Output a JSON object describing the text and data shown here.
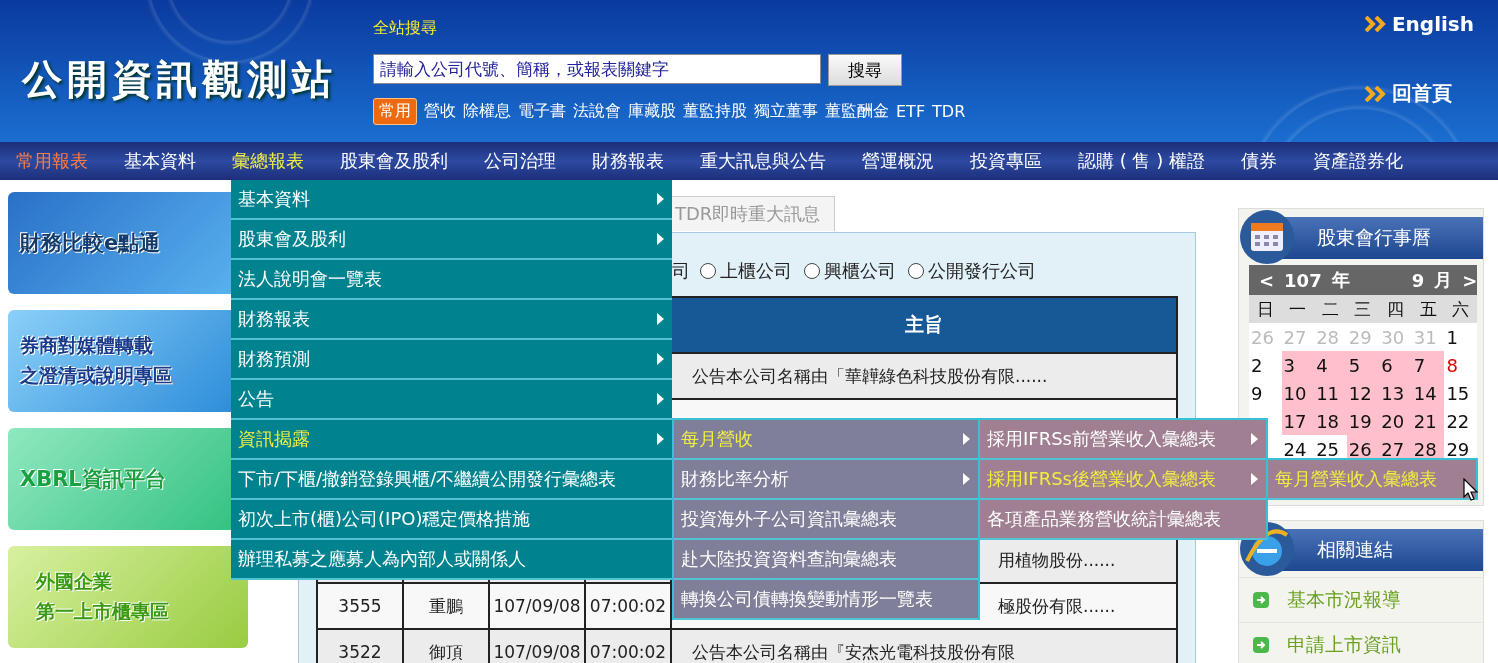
{
  "header": {
    "logo": "公開資訊觀測站",
    "search_label": "全站搜尋",
    "search": {
      "placeholder": "請輸入公司代號、簡稱，或報表關鍵字"
    },
    "search_button": "搜尋",
    "quick_badge": "常用",
    "quick_links": [
      "營收",
      "除權息",
      "電子書",
      "法說會",
      "庫藏股",
      "董監持股",
      "獨立董事",
      "董監酬金",
      "ETF",
      "TDR"
    ],
    "english_link": "English",
    "home_link": "回首頁"
  },
  "nav": [
    {
      "label": "常用報表",
      "selected": true,
      "open": false
    },
    {
      "label": "基本資料",
      "selected": false,
      "open": false
    },
    {
      "label": "彙總報表",
      "selected": false,
      "open": true,
      "menu": [
        {
          "label": "基本資料",
          "has_submenu": true,
          "active": false
        },
        {
          "label": "股東會及股利",
          "has_submenu": true,
          "active": false
        },
        {
          "label": "法人說明會一覽表",
          "has_submenu": false,
          "active": false
        },
        {
          "label": "財務報表",
          "has_submenu": true,
          "active": false
        },
        {
          "label": "財務預測",
          "has_submenu": true,
          "active": false
        },
        {
          "label": "公告",
          "has_submenu": true,
          "active": false
        },
        {
          "label": "資訊揭露",
          "has_submenu": true,
          "active": true,
          "children": [
            {
              "label": "每月營收",
              "has_submenu": true,
              "active": true,
              "children": [
                {
                  "label": "採用IFRSs前營業收入彙總表",
                  "has_submenu": true,
                  "active": false
                },
                {
                  "label": "採用IFRSs後營業收入彙總表",
                  "has_submenu": true,
                  "active": true,
                  "children": [
                    {
                      "label": "每月營業收入彙總表",
                      "has_submenu": false,
                      "active": true
                    }
                  ]
                },
                {
                  "label": "各項產品業務營收統計彙總表",
                  "has_submenu": false,
                  "active": false
                }
              ]
            },
            {
              "label": "財務比率分析",
              "has_submenu": true,
              "active": false
            },
            {
              "label": "投資海外子公司資訊彙總表",
              "has_submenu": false,
              "active": false
            },
            {
              "label": "赴大陸投資資料查詢彙總表",
              "has_submenu": false,
              "active": false
            },
            {
              "label": "轉換公司債轉換變動情形一覽表",
              "has_submenu": false,
              "active": false
            }
          ]
        },
        {
          "label": "下市/下櫃/撤銷登錄興櫃/不繼續公開發行彙總表",
          "has_submenu": false,
          "active": false
        },
        {
          "label": "初次上市(櫃)公司(IPO)穩定價格措施",
          "has_submenu": false,
          "active": false
        },
        {
          "label": "辦理私募之應募人為內部人或關係人",
          "has_submenu": false,
          "active": false
        }
      ]
    },
    {
      "label": "股東會及股利",
      "selected": false,
      "open": false
    },
    {
      "label": "公司治理",
      "selected": false,
      "open": false
    },
    {
      "label": "財務報表",
      "selected": false,
      "open": false
    },
    {
      "label": "重大訊息與公告",
      "selected": false,
      "open": false
    },
    {
      "label": "營運概況",
      "selected": false,
      "open": false
    },
    {
      "label": "投資專區",
      "selected": false,
      "open": false
    },
    {
      "label": "認購 ( 售 ) 權證",
      "selected": false,
      "open": false
    },
    {
      "label": "債券",
      "selected": false,
      "open": false
    },
    {
      "label": "資產證券化",
      "selected": false,
      "open": false
    }
  ],
  "banners": [
    {
      "lines": [
        "財務比較e點通"
      ]
    },
    {
      "lines": [
        "券商對媒體轉載",
        "之澄清或說明專區"
      ]
    },
    {
      "lines": [
        "XBRL資訊平台"
      ]
    },
    {
      "lines": [
        "外國企業",
        "第一上市櫃專區"
      ]
    }
  ],
  "tabs": [
    {
      "label": "TDR即時重大訊息",
      "selected": false
    }
  ],
  "market_filter": {
    "fragment": "司",
    "options": [
      {
        "label": "上櫃公司",
        "selected": false
      },
      {
        "label": "興櫃公司",
        "selected": false
      },
      {
        "label": "公開發行公司",
        "selected": false
      }
    ]
  },
  "table": {
    "subject_heading": "主旨",
    "rows": [
      {
        "subject": "公告本公司名稱由「華韡綠色科技股份有限......"
      },
      {},
      {},
      {},
      {
        "subject_tail": "用植物股份......"
      },
      {
        "code": "3555",
        "name": "重鵬",
        "date": "107/09/08",
        "time": "07:00:02",
        "subject_tail": "極股份有限......"
      },
      {
        "code": "3522",
        "name": "御頂",
        "date": "107/09/08",
        "time": "07:00:02",
        "subject": "公告本公司名稱由『安杰光電科技股份有限"
      }
    ]
  },
  "calendar": {
    "title": "股東會行事曆",
    "prev": "<",
    "year": "107",
    "year_unit": "年",
    "month": "9",
    "month_unit": "月",
    "next": ">",
    "weekdays": [
      "日",
      "一",
      "二",
      "三",
      "四",
      "五",
      "六"
    ],
    "days": [
      {
        "kind": "other",
        "day": "26"
      },
      {
        "kind": "other",
        "day": "27"
      },
      {
        "kind": "other",
        "day": "28"
      },
      {
        "kind": "other",
        "day": "29"
      },
      {
        "kind": "other",
        "day": "30"
      },
      {
        "kind": "other",
        "day": "31"
      },
      {
        "kind": "day",
        "day": "1",
        "highlighted": false,
        "holiday": false
      },
      {
        "kind": "day",
        "day": "2",
        "highlighted": false,
        "holiday": false
      },
      {
        "kind": "day",
        "day": "3",
        "highlighted": true,
        "holiday": false
      },
      {
        "kind": "day",
        "day": "4",
        "highlighted": true,
        "holiday": false
      },
      {
        "kind": "day",
        "day": "5",
        "highlighted": true,
        "holiday": false
      },
      {
        "kind": "day",
        "day": "6",
        "highlighted": true,
        "holiday": false
      },
      {
        "kind": "day",
        "day": "7",
        "highlighted": true,
        "holiday": false
      },
      {
        "kind": "day",
        "day": "8",
        "highlighted": false,
        "holiday": true
      },
      {
        "kind": "day",
        "day": "9",
        "highlighted": false,
        "holiday": false
      },
      {
        "kind": "day",
        "day": "10",
        "highlighted": true,
        "holiday": false
      },
      {
        "kind": "day",
        "day": "11",
        "highlighted": true,
        "holiday": false
      },
      {
        "kind": "day",
        "day": "12",
        "highlighted": true,
        "holiday": false
      },
      {
        "kind": "day",
        "day": "13",
        "highlighted": true,
        "holiday": false
      },
      {
        "kind": "day",
        "day": "14",
        "highlighted": true,
        "holiday": false
      },
      {
        "kind": "day",
        "day": "15",
        "highlighted": false,
        "holiday": false
      },
      {
        "kind": "covered"
      },
      {
        "kind": "day",
        "day": "17",
        "highlighted": true,
        "holiday": false
      },
      {
        "kind": "day",
        "day": "18",
        "highlighted": true,
        "holiday": false
      },
      {
        "kind": "day",
        "day": "19",
        "highlighted": true,
        "holiday": false
      },
      {
        "kind": "day",
        "day": "20",
        "highlighted": true,
        "holiday": false
      },
      {
        "kind": "day",
        "day": "21",
        "highlighted": true,
        "holiday": false
      },
      {
        "kind": "day",
        "day": "22",
        "highlighted": false,
        "holiday": false
      },
      {
        "kind": "covered"
      },
      {
        "kind": "day",
        "day": "24",
        "highlighted": false,
        "holiday": false
      },
      {
        "kind": "day",
        "day": "25",
        "highlighted": false,
        "holiday": false
      },
      {
        "kind": "day",
        "day": "26",
        "highlighted": true,
        "holiday": false
      },
      {
        "kind": "day",
        "day": "27",
        "highlighted": true,
        "holiday": false
      },
      {
        "kind": "day",
        "day": "28",
        "highlighted": true,
        "holiday": false
      },
      {
        "kind": "day",
        "day": "29",
        "highlighted": false,
        "holiday": false
      }
    ]
  },
  "related": {
    "title": "相關連結",
    "links": [
      "基本市況報導",
      "申請上市資訊"
    ]
  }
}
